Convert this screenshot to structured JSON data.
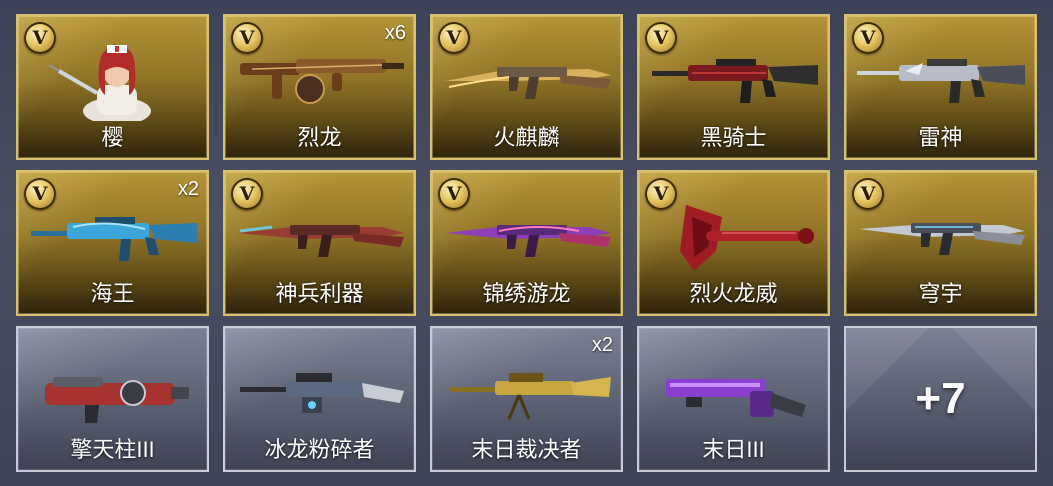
{
  "items": [
    {
      "name": "樱",
      "quantity": "",
      "rarity": "gold",
      "icon": "nurse-character-icon",
      "color": "#c33a3a"
    },
    {
      "name": "烈龙",
      "quantity": "x6",
      "rarity": "gold",
      "icon": "smg-drum-icon",
      "color": "#7a4a22"
    },
    {
      "name": "火麒麟",
      "quantity": "",
      "rarity": "gold",
      "icon": "ak-rifle-icon",
      "color": "#c9a04a"
    },
    {
      "name": "黑骑士",
      "quantity": "",
      "rarity": "gold",
      "icon": "m4-rifle-icon",
      "color": "#8a1f24"
    },
    {
      "name": "雷神",
      "quantity": "",
      "rarity": "gold",
      "icon": "m4-rifle-icon",
      "color": "#b8bcc8"
    },
    {
      "name": "海王",
      "quantity": "x2",
      "rarity": "gold",
      "icon": "m4-rifle-icon",
      "color": "#3aa6d9"
    },
    {
      "name": "神兵利器",
      "quantity": "",
      "rarity": "gold",
      "icon": "ak-rifle-icon",
      "color": "#9a3b34"
    },
    {
      "name": "锦绣游龙",
      "quantity": "",
      "rarity": "gold",
      "icon": "ak-rifle-icon",
      "color": "#8c3fb8"
    },
    {
      "name": "烈火龙威",
      "quantity": "",
      "rarity": "gold",
      "icon": "axe-icon",
      "color": "#b0202a"
    },
    {
      "name": "穹宇",
      "quantity": "",
      "rarity": "gold",
      "icon": "ak-rifle-icon",
      "color": "#c4c8d2"
    },
    {
      "name": "擎天柱III",
      "quantity": "",
      "rarity": "silver",
      "icon": "heavy-gun-icon",
      "color": "#a8322e"
    },
    {
      "name": "冰龙粉碎者",
      "quantity": "",
      "rarity": "silver",
      "icon": "machine-gun-icon",
      "color": "#5b6a80"
    },
    {
      "name": "末日裁决者",
      "quantity": "x2",
      "rarity": "silver",
      "icon": "machine-gun-icon",
      "color": "#c8a640"
    },
    {
      "name": "末日III",
      "quantity": "",
      "rarity": "silver",
      "icon": "heavy-gun-icon",
      "color": "#8a3fd0"
    }
  ],
  "more": {
    "label": "+7"
  },
  "badge": {
    "letter": "V"
  }
}
